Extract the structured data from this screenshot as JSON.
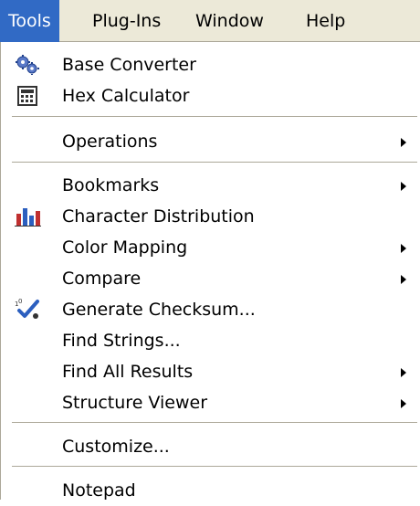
{
  "menubar": {
    "items": [
      {
        "label": "Tools"
      },
      {
        "label": "Plug-Ins"
      },
      {
        "label": "Window"
      },
      {
        "label": "Help"
      }
    ]
  },
  "tools_menu": {
    "items": [
      {
        "label": "Base Converter",
        "icon": "gears-icon"
      },
      {
        "label": "Hex Calculator",
        "icon": "calculator-icon"
      },
      {
        "label": "Operations",
        "submenu": true
      },
      {
        "label": "Bookmarks",
        "submenu": true
      },
      {
        "label": "Character Distribution",
        "icon": "bar-chart-icon"
      },
      {
        "label": "Color Mapping",
        "submenu": true
      },
      {
        "label": "Compare",
        "submenu": true
      },
      {
        "label": "Generate Checksum...",
        "icon": "checksum-icon"
      },
      {
        "label": "Find Strings..."
      },
      {
        "label": "Find All Results",
        "submenu": true
      },
      {
        "label": "Structure Viewer",
        "submenu": true
      },
      {
        "label": "Customize..."
      },
      {
        "label": "Notepad"
      }
    ]
  },
  "colors": {
    "menubar_bg": "#ece9d8",
    "highlight": "#316ac5",
    "separator": "#aca899"
  }
}
